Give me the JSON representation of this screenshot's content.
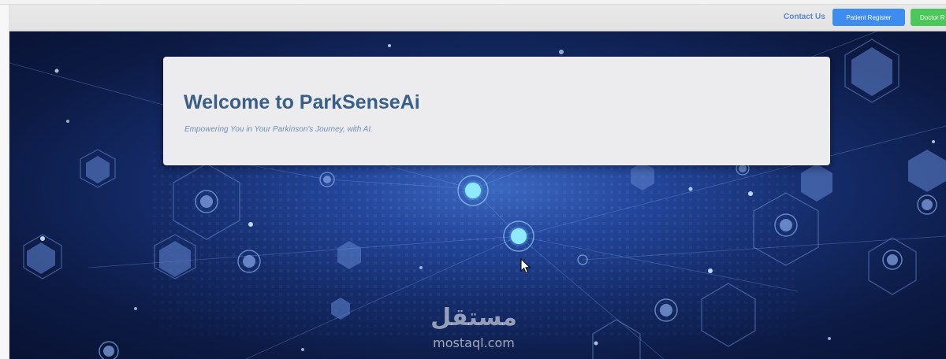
{
  "navbar": {
    "contact_label": "Contact Us",
    "patient_register_label": "Patient Register",
    "doctor_register_label": "Doctor R"
  },
  "hero": {
    "title": "Welcome to ParkSenseAi",
    "subtitle": "Empowering You in Your Parkinson's Journey, with AI."
  },
  "watermark": {
    "arabic": "مستقل",
    "latin": "mostaql.com"
  },
  "colors": {
    "patient_button": "#3f8cf0",
    "doctor_button": "#4cc75a",
    "contact_link": "#5a86c4",
    "title_text": "#3a5f86",
    "hero_background": "#152c6a"
  },
  "icons": {
    "cursor": "mouse-pointer-icon"
  }
}
